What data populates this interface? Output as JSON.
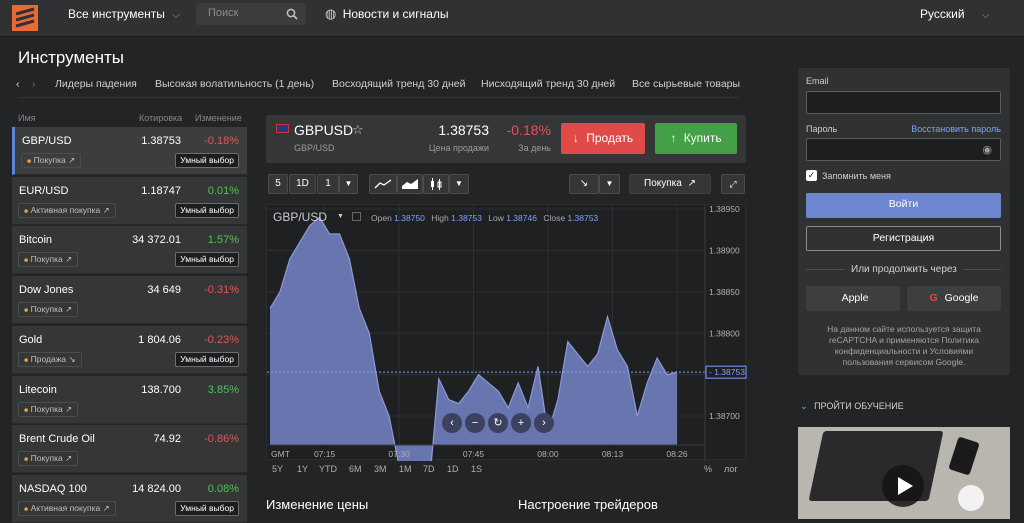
{
  "header": {
    "all_instruments": "Все инструменты",
    "search_placeholder": "Поиск",
    "news": "Новости и сигналы",
    "language": "Русский"
  },
  "page": {
    "title": "Инструменты",
    "categories": [
      "Лидеры падения",
      "Высокая волатильность (1 день)",
      "Восходящий тренд 30 дней",
      "Нисходящий тренд 30 дней",
      "Все сырьевые товары"
    ]
  },
  "list": {
    "headers": {
      "name": "Имя",
      "quote": "Котировка",
      "change": "Изменение"
    },
    "rows": [
      {
        "name": "GBP/USD",
        "price": "1.38753",
        "change": "-0.18%",
        "dir": "neg",
        "tag": "Покупка ↗",
        "smart": "Умный выбор"
      },
      {
        "name": "EUR/USD",
        "price": "1.18747",
        "change": "0.01%",
        "dir": "pos",
        "tag": "Активная покупка ↗",
        "smart": "Умный выбор"
      },
      {
        "name": "Bitcoin",
        "price": "34 372.01",
        "change": "1.57%",
        "dir": "pos",
        "tag": "Покупка ↗",
        "smart": "Умный выбор"
      },
      {
        "name": "Dow Jones",
        "price": "34 649",
        "change": "-0.31%",
        "dir": "neg",
        "tag": "Покупка ↗",
        "smart": ""
      },
      {
        "name": "Gold",
        "price": "1 804.06",
        "change": "-0.23%",
        "dir": "neg",
        "tag": "Продажа ↘",
        "smart": "Умный выбор"
      },
      {
        "name": "Litecoin",
        "price": "138.700",
        "change": "3.85%",
        "dir": "pos",
        "tag": "Покупка ↗",
        "smart": ""
      },
      {
        "name": "Brent Crude Oil",
        "price": "74.92",
        "change": "-0.86%",
        "dir": "neg",
        "tag": "Покупка ↗",
        "smart": ""
      },
      {
        "name": "NASDAQ 100",
        "price": "14 824.00",
        "change": "0.08%",
        "dir": "pos",
        "tag": "Активная покупка ↗",
        "smart": "Умный выбор"
      }
    ]
  },
  "quote": {
    "symbol": "GBPUSD",
    "sub": "GBP/USD",
    "price": "1.38753",
    "price_label": "Цена продажи",
    "change": "-0.18%",
    "change_label": "За день",
    "sell": "Продать",
    "buy": "Купить"
  },
  "toolbar": {
    "period1": "5",
    "period2": "1D",
    "period3": "1",
    "signal": "Покупка"
  },
  "chart_data": {
    "type": "area",
    "symbol_label": "GBP/USD",
    "ohlc": {
      "open_label": "Open",
      "open": "1.38750",
      "high_label": "High",
      "high": "1.38753",
      "low_label": "Low",
      "low": "1.38746",
      "close_label": "Close",
      "close": "1.38753"
    },
    "y_ticks": [
      "1.38950",
      "1.38900",
      "1.38850",
      "1.38800",
      "1.38750",
      "1.38700"
    ],
    "current": "1.38753",
    "x_ticks": [
      "07:15",
      "07:30",
      "07:45",
      "08:00",
      "08:13",
      "08:26"
    ],
    "x_label": "GMT",
    "ylim": [
      1.38665,
      1.38955
    ],
    "x": [
      "07:04",
      "07:06",
      "07:08",
      "07:10",
      "07:12",
      "07:14",
      "07:16",
      "07:18",
      "07:20",
      "07:22",
      "07:24",
      "07:26",
      "07:28",
      "07:30",
      "07:32",
      "07:34",
      "07:36",
      "07:38",
      "07:40",
      "07:42",
      "07:44",
      "07:46",
      "07:48",
      "07:50",
      "07:52",
      "07:54",
      "07:56",
      "07:58",
      "08:00",
      "08:02",
      "08:04",
      "08:06",
      "08:08",
      "08:10",
      "08:12",
      "08:14",
      "08:16",
      "08:18",
      "08:20",
      "08:22",
      "08:24",
      "08:26"
    ],
    "values": [
      1.3883,
      1.3885,
      1.3889,
      1.3891,
      1.3893,
      1.3894,
      1.3892,
      1.3892,
      1.3889,
      1.3883,
      1.388,
      1.3873,
      1.387,
      1.3864,
      1.3862,
      1.386,
      1.3861,
      1.38745,
      1.3872,
      1.38715,
      1.3873,
      1.3875,
      1.3874,
      1.3873,
      1.3871,
      1.3874,
      1.3871,
      1.3876,
      1.3868,
      1.3872,
      1.3879,
      1.38775,
      1.3876,
      1.38775,
      1.3882,
      1.3878,
      1.3876,
      1.387,
      1.3874,
      1.3877,
      1.3875,
      1.38753
    ],
    "timeframes": [
      "5Y",
      "1Y",
      "YTD",
      "6M",
      "3M",
      "1M",
      "7D",
      "1D",
      "1S"
    ],
    "pct": "%",
    "log": "лог"
  },
  "sections": {
    "price_change": "Изменение цены",
    "sentiment": "Настроение трейдеров"
  },
  "login": {
    "email_label": "Email",
    "password_label": "Пароль",
    "restore": "Восстановить пароль",
    "remember": "Запомнить меня",
    "login_btn": "Войти",
    "register_btn": "Регистрация",
    "or_continue": "Или продолжить через",
    "apple": "Apple",
    "google": "Google",
    "fine_print": "На данном сайте используется защита reCAPTCHA и применяются Политика конфиденциальности и Условиями пользования сервисом Google."
  },
  "learn": {
    "title": "ПРОЙТИ ОБУЧЕНИЕ"
  },
  "colors": {
    "accent": "#5a86d8",
    "sell": "#e04b48",
    "buy": "#43a047",
    "area": "#6f7dbb"
  }
}
